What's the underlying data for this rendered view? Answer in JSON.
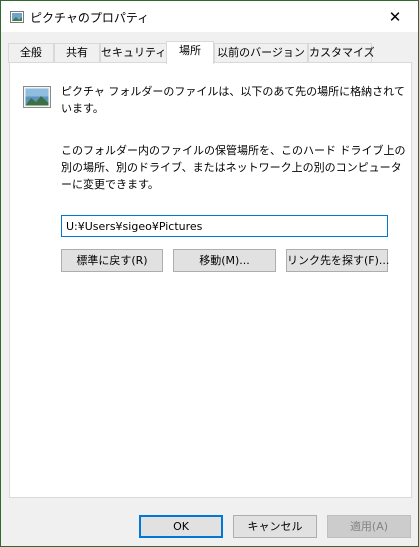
{
  "window": {
    "title": "ピクチャのプロパティ",
    "close_glyph": "✕",
    "icon": "picture-folder-icon"
  },
  "tabs": [
    {
      "label": "全般"
    },
    {
      "label": "共有"
    },
    {
      "label": "セキュリティ"
    },
    {
      "label": "場所",
      "active": true
    },
    {
      "label": "以前のバージョン"
    },
    {
      "label": "カスタマイズ"
    }
  ],
  "location": {
    "description": "ピクチャ フォルダーのファイルは、以下のあて先の場所に格納されています。",
    "instructions": "このフォルダー内のファイルの保管場所を、このハード ドライブ上の別の場所、別のドライブ、またはネットワーク上の別のコンピューターに変更できます。",
    "path_value": "U:¥Users¥sigeo¥Pictures",
    "restore_default_label": "標準に戻す(R)",
    "move_label": "移動(M)...",
    "find_target_label": "リンク先を探す(F)..."
  },
  "footer": {
    "ok_label": "OK",
    "cancel_label": "キャンセル",
    "apply_label": "適用(A)"
  },
  "colors": {
    "accent": "#0078d7",
    "window_border": "#2e6b2e"
  }
}
